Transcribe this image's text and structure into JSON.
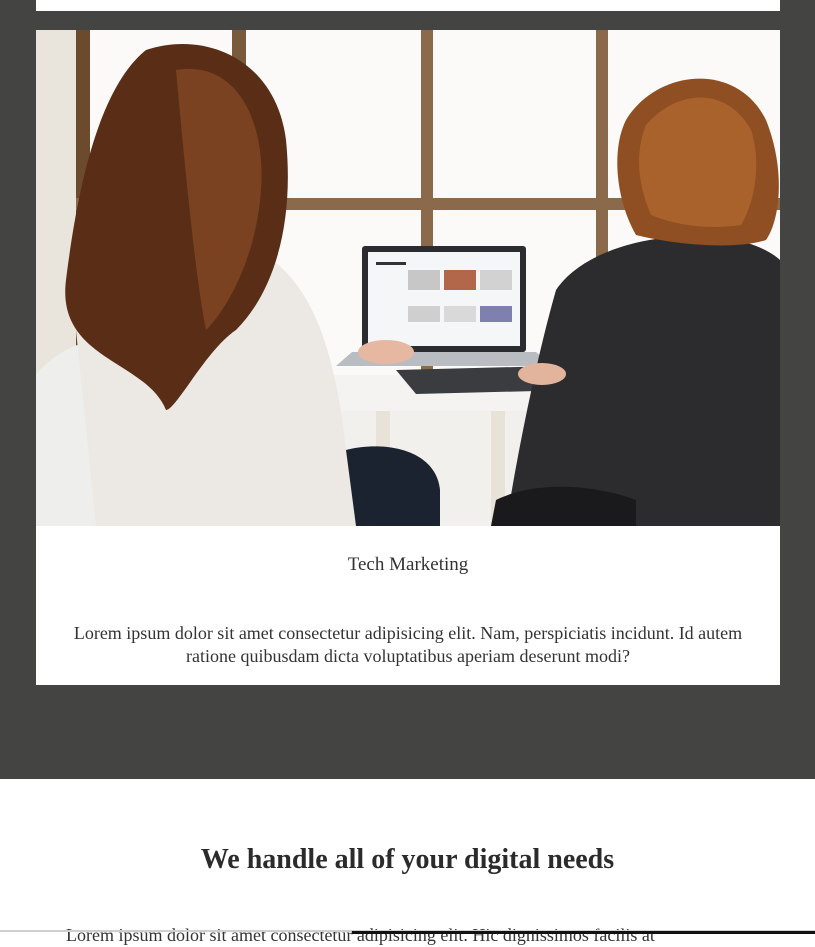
{
  "service_card": {
    "title": "Tech Marketing",
    "description": "Lorem ipsum dolor sit amet consectetur adipisicing elit. Nam, perspiciatis incidunt. Id autem ratione quibusdam dicta voluptatibus aperiam deserunt modi?",
    "image_icon": "photo-two-women-at-laptop"
  },
  "digital_section": {
    "heading": "We handle all of your digital needs",
    "intro": "Lorem ipsum dolor sit amet consectetur adipisicing elit. Hic dignissimos facilis at"
  },
  "colors": {
    "dark_band": "#444443",
    "card_bg": "#ffffff",
    "text": "#2b2b2b"
  }
}
